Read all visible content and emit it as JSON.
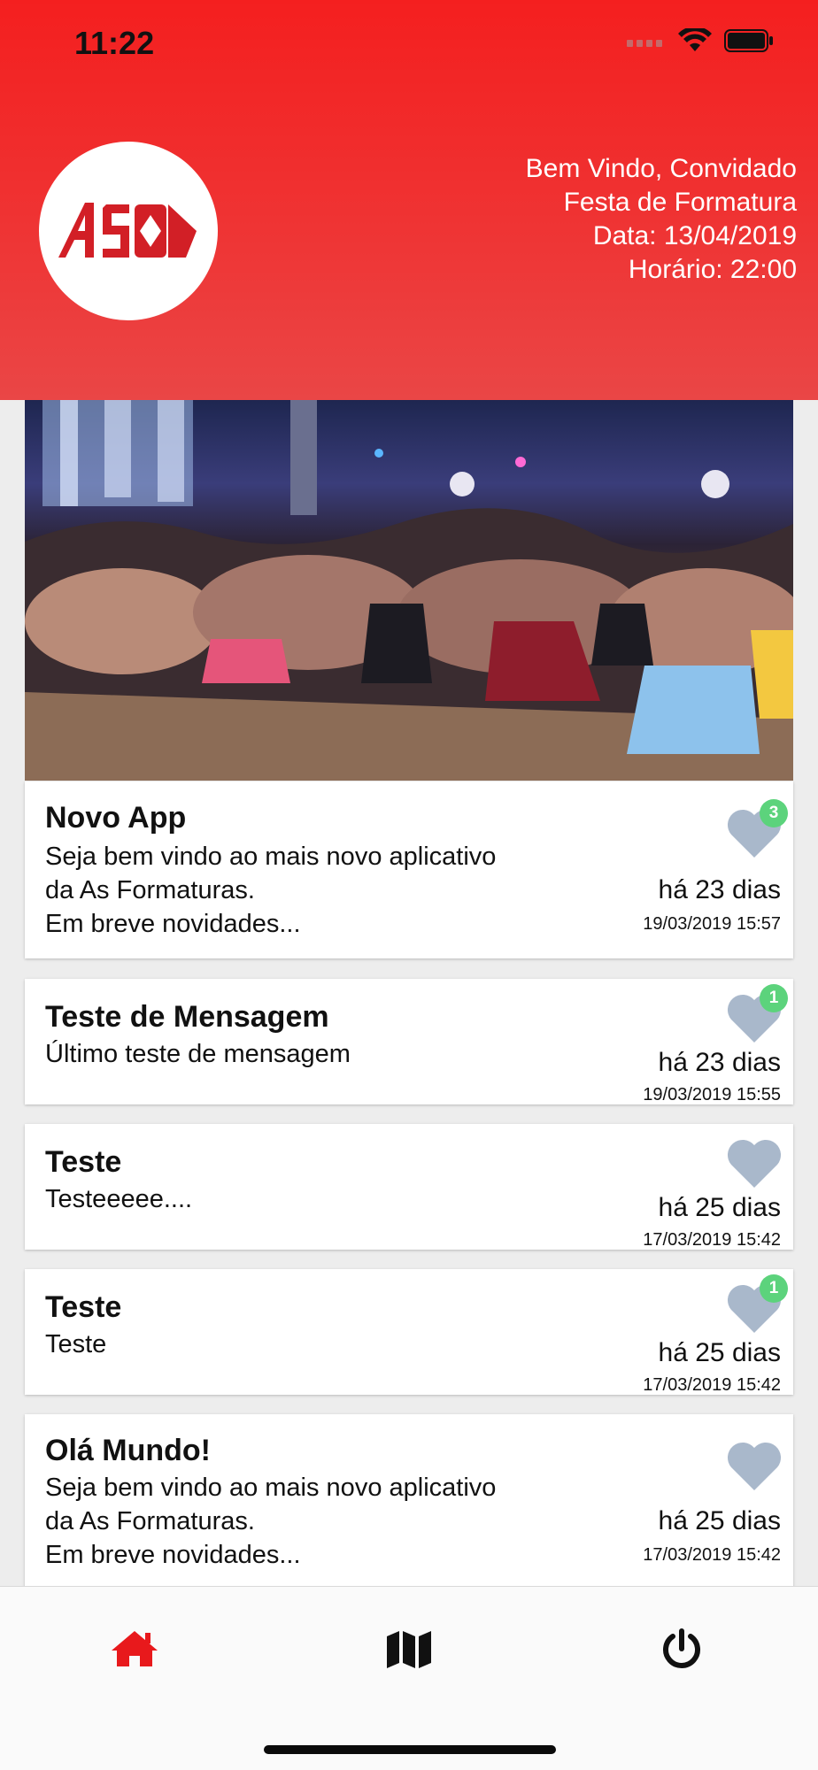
{
  "status_bar": {
    "time": "11:22"
  },
  "header": {
    "welcome": "Bem Vindo, Convidado",
    "event": "Festa de Formatura",
    "date": "Data: 13/04/2019",
    "time": "Horário: 22:00",
    "brand_color": "#f41f1f"
  },
  "banner": {
    "image": "formatura-group-photo"
  },
  "messages": [
    {
      "title": "Novo App",
      "body": "Seja bem vindo ao mais novo aplicativo\nda As Formaturas.\nEm breve novidades...",
      "ago": "há 23 dias",
      "stamp": "19/03/2019 15:57",
      "likes": "3"
    },
    {
      "title": "Teste de Mensagem",
      "body": "Último teste de mensagem",
      "ago": "há 23 dias",
      "stamp": "19/03/2019 15:55",
      "likes": "1"
    },
    {
      "title": "Teste",
      "body": "Testeeeee....",
      "ago": "há 25 dias",
      "stamp": "17/03/2019 15:42",
      "likes": ""
    },
    {
      "title": "Teste",
      "body": "Teste",
      "ago": "há 25 dias",
      "stamp": "17/03/2019 15:42",
      "likes": "1"
    },
    {
      "title": "Olá Mundo!",
      "body": "Seja bem vindo ao mais novo aplicativo\nda As Formaturas.\nEm breve novidades...",
      "ago": "há 25 dias",
      "stamp": "17/03/2019 15:42",
      "likes": ""
    }
  ],
  "tabs": [
    {
      "icon": "home-icon",
      "active": true
    },
    {
      "icon": "map-icon",
      "active": false
    },
    {
      "icon": "power-icon",
      "active": false
    }
  ],
  "colors": {
    "active_tab": "#e8191c",
    "heart": "#a9b8cb",
    "badge": "#5cd37c"
  }
}
